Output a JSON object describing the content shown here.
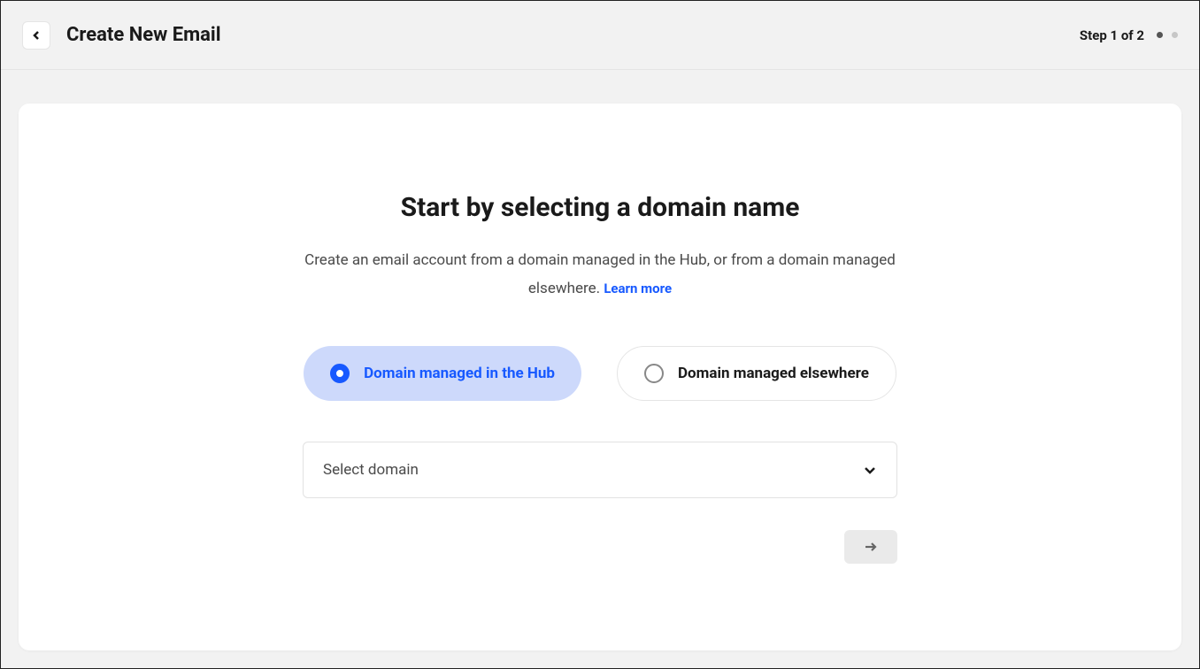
{
  "header": {
    "title": "Create New Email",
    "step_label": "Step 1 of 2"
  },
  "main": {
    "heading": "Start by selecting a domain name",
    "description": "Create an email account from a domain managed in the Hub, or from a domain managed elsewhere. ",
    "learn_more": "Learn more"
  },
  "options": {
    "hub_label": "Domain managed in the Hub",
    "elsewhere_label": "Domain managed elsewhere",
    "selected": "hub"
  },
  "select": {
    "placeholder": "Select domain"
  }
}
